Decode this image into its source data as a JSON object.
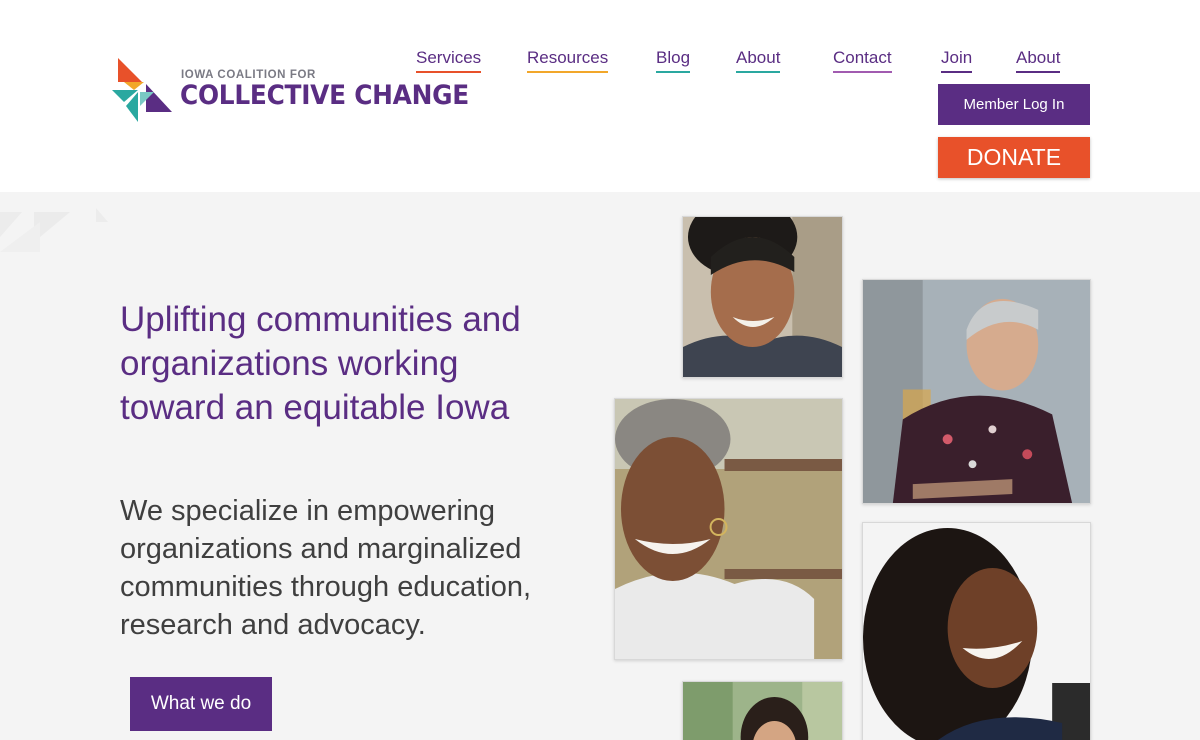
{
  "brand": {
    "small_text": "IOWA COALITION FOR",
    "big_text": "COLLECTIVE CHANGE",
    "colors": {
      "purple": "#5a2d83",
      "orange": "#e8512a",
      "teal": "#2aa8a0",
      "yellow": "#f2a72a"
    }
  },
  "nav": {
    "items": [
      {
        "label": "Services",
        "underline": "#e8512a"
      },
      {
        "label": "Resources",
        "underline": "#f2a72a"
      },
      {
        "label": "Blog",
        "underline": "#2aa8a0"
      },
      {
        "label": "About",
        "underline": "#2aa8a0"
      },
      {
        "label": "Contact",
        "underline": "#a15bb0"
      },
      {
        "label": "Join",
        "underline": "#5a2d83"
      },
      {
        "label": "About",
        "underline": "#5a2d83"
      }
    ],
    "member_login": "Member Log In",
    "donate": "DONATE"
  },
  "hero": {
    "heading": "Uplifting communities and organizations working toward an equitable Iowa",
    "subheading": "We specialize in empowering organizations and marginalized communities through education, research and advocacy.",
    "cta": "What we do",
    "photos": [
      {
        "name": "photo-older-woman-smiling",
        "icon": "portrait"
      },
      {
        "name": "photo-person-short-hair",
        "icon": "portrait"
      },
      {
        "name": "photo-woman-gray-curly-hair",
        "icon": "portrait"
      },
      {
        "name": "photo-young-woman-curly-hair",
        "icon": "portrait"
      },
      {
        "name": "photo-woman-outdoors",
        "icon": "portrait"
      }
    ]
  }
}
